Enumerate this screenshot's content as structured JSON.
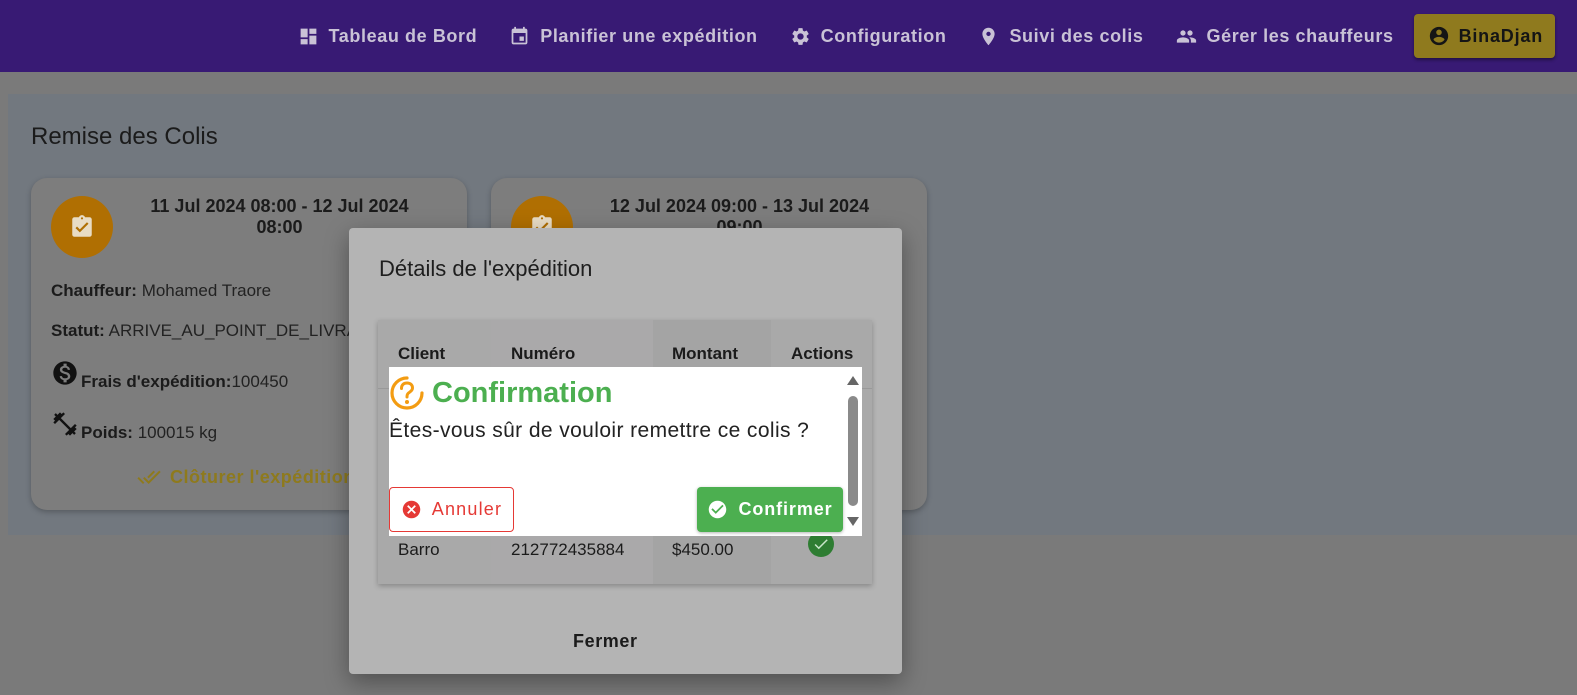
{
  "nav": {
    "items": [
      {
        "label": "Tableau de Bord",
        "icon": "dashboard-icon"
      },
      {
        "label": "Planifier une expédition",
        "icon": "calendar-icon"
      },
      {
        "label": "Configuration",
        "icon": "gear-icon"
      },
      {
        "label": "Suivi des colis",
        "icon": "location-pin-icon"
      },
      {
        "label": "Gérer les chauffeurs",
        "icon": "people-icon"
      }
    ],
    "user": {
      "label": "BinaDjan",
      "icon": "account-circle-icon"
    }
  },
  "page": {
    "title": "Remise des Colis"
  },
  "cards": [
    {
      "date": "11 Jul 2024 08:00 - 12 Jul 2024 08:00",
      "driver_label": "Chauffeur:",
      "driver_value": "Mohamed Traore",
      "status_label": "Statut:",
      "status_value": "ARRIVE_AU_POINT_DE_LIVRA",
      "fees_label": "Frais d'expédition:",
      "fees_value": "100450",
      "weight_label": "Poids:",
      "weight_value": "100015 kg",
      "close_label": "Clôturer l'expédition"
    },
    {
      "date": "12 Jul 2024 09:00 - 13 Jul 2024 09:00"
    }
  ],
  "details_dialog": {
    "title": "Détails de l'expédition",
    "columns": [
      "Client",
      "Numéro",
      "Montant",
      "Actions"
    ],
    "visible_row": {
      "client": "Barro",
      "numero": "212772435884",
      "montant": "$450.00"
    },
    "close_label": "Fermer"
  },
  "confirm_dialog": {
    "title": "Confirmation",
    "message": "Êtes-vous sûr de vouloir remettre ce colis ?",
    "cancel_label": "Annuler",
    "confirm_label": "Confirmer"
  },
  "colors": {
    "navbar": "#381a74",
    "user_button": "#8f7a1e",
    "confirm_green": "#4caf50",
    "cancel_red": "#e53935",
    "question_orange": "#f39c12"
  }
}
